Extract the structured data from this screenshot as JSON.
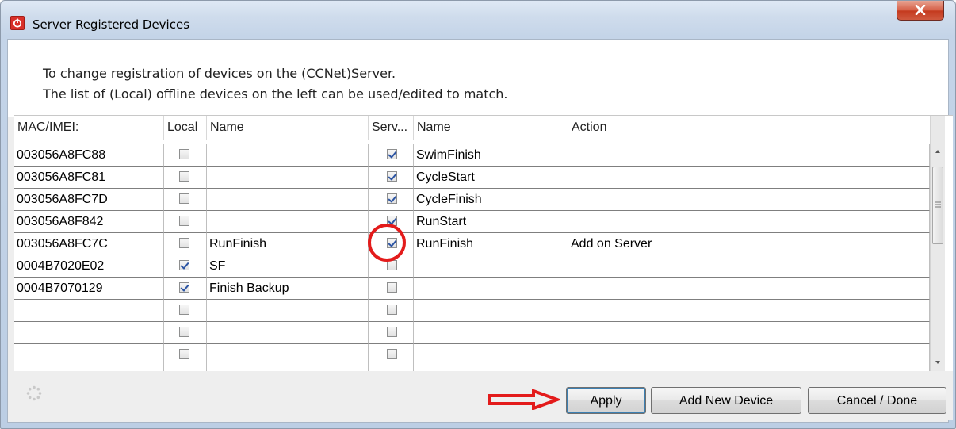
{
  "window": {
    "title": "Server Registered Devices",
    "app_icon": "power-icon",
    "close_icon": "close-x-icon"
  },
  "info": {
    "line1": "To change registration of devices on the (CCNet)Server.",
    "line2": "The list of (Local) offline devices on the left can be used/edited to match."
  },
  "table": {
    "headers": [
      "MAC/IMEI:",
      "Local",
      "Name",
      "Serv...",
      "Name",
      "Action"
    ],
    "rows": [
      {
        "mac": "003056A8FC88",
        "local": false,
        "local_name": "",
        "server": true,
        "server_name": "SwimFinish",
        "action": ""
      },
      {
        "mac": "003056A8FC81",
        "local": false,
        "local_name": "",
        "server": true,
        "server_name": "CycleStart",
        "action": ""
      },
      {
        "mac": "003056A8FC7D",
        "local": false,
        "local_name": "",
        "server": true,
        "server_name": "CycleFinish",
        "action": ""
      },
      {
        "mac": "003056A8F842",
        "local": false,
        "local_name": "",
        "server": true,
        "server_name": "RunStart",
        "action": ""
      },
      {
        "mac": "003056A8FC7C",
        "local": false,
        "local_name": "RunFinish",
        "server": true,
        "server_name": "RunFinish",
        "action": "Add on Server"
      },
      {
        "mac": "0004B7020E02",
        "local": true,
        "local_name": "SF",
        "server": false,
        "server_name": "",
        "action": ""
      },
      {
        "mac": "0004B7070129",
        "local": true,
        "local_name": "Finish Backup",
        "server": false,
        "server_name": "",
        "action": ""
      },
      {
        "mac": "",
        "local": false,
        "local_name": "",
        "server": false,
        "server_name": "",
        "action": ""
      },
      {
        "mac": "",
        "local": false,
        "local_name": "",
        "server": false,
        "server_name": "",
        "action": ""
      },
      {
        "mac": "",
        "local": false,
        "local_name": "",
        "server": false,
        "server_name": "",
        "action": ""
      },
      {
        "mac": "",
        "local": false,
        "local_name": "",
        "server": false,
        "server_name": "",
        "action": ""
      }
    ]
  },
  "footer": {
    "spinner_icon": "loading-spinner-icon",
    "apply_label": "Apply",
    "add_label": "Add New Device",
    "cancel_label": "Cancel / Done"
  },
  "annotations": {
    "arrow": "red-arrow-icon",
    "circle": "red-circle-highlight",
    "color": "#e31b1b"
  }
}
